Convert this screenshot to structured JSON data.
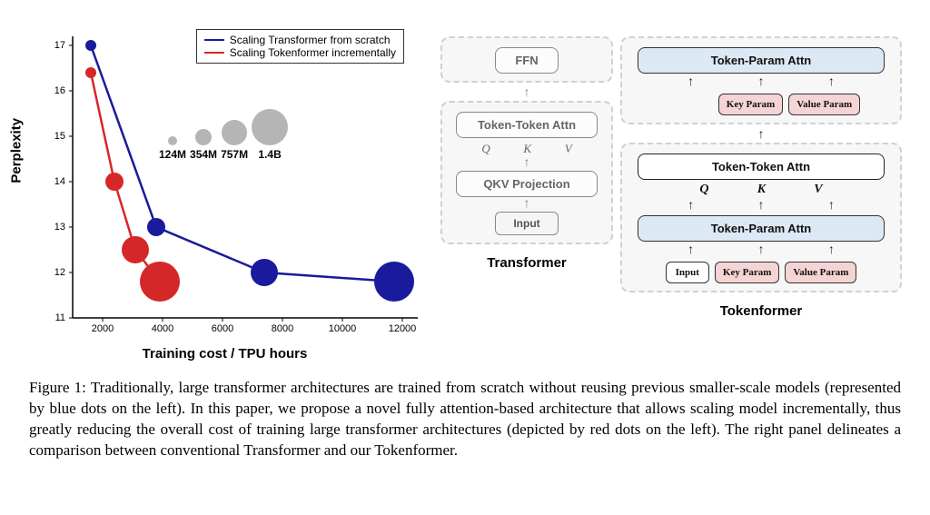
{
  "chart_data": {
    "type": "scatter-line",
    "xlabel": "Training cost / TPU hours",
    "ylabel": "Perplexity",
    "xlim": [
      1000,
      12500
    ],
    "ylim": [
      11,
      17.2
    ],
    "xticks": [
      2000,
      4000,
      6000,
      8000,
      10000,
      12000
    ],
    "yticks": [
      11,
      12,
      13,
      14,
      15,
      16,
      17
    ],
    "series": [
      {
        "name": "Scaling Transformer from scratch",
        "color": "#1a1a9c",
        "points": [
          {
            "x": 1600,
            "y": 17.0,
            "size": "124M"
          },
          {
            "x": 3800,
            "y": 13.0,
            "size": "354M"
          },
          {
            "x": 7400,
            "y": 12.0,
            "size": "757M"
          },
          {
            "x": 11700,
            "y": 11.8,
            "size": "1.4B"
          }
        ]
      },
      {
        "name": "Scaling Tokenformer incrementally",
        "color": "#d62728",
        "points": [
          {
            "x": 1600,
            "y": 16.4,
            "size": "124M"
          },
          {
            "x": 2400,
            "y": 14.0,
            "size": "354M"
          },
          {
            "x": 3100,
            "y": 12.5,
            "size": "757M"
          },
          {
            "x": 3900,
            "y": 11.8,
            "size": "1.4B"
          }
        ]
      }
    ],
    "size_legend": [
      "124M",
      "354M",
      "757M",
      "1.4B"
    ]
  },
  "legend": {
    "line1": "Scaling Transformer from scratch",
    "line2": "Scaling Tokenformer incrementally"
  },
  "size_keys": {
    "s0": "124M",
    "s1": "354M",
    "s2": "757M",
    "s3": "1.4B"
  },
  "arch_left": {
    "ffn": "FFN",
    "tta": "Token-Token Attn",
    "q": "Q",
    "k": "K",
    "v": "V",
    "qkv_proj": "QKV Projection",
    "input": "Input",
    "label": "Transformer"
  },
  "arch_right": {
    "tpa": "Token-Param Attn",
    "key_param": "Key Param",
    "value_param": "Value Param",
    "tta": "Token-Token Attn",
    "q": "Q",
    "k": "K",
    "v": "V",
    "input": "Input",
    "label": "Tokenformer"
  },
  "caption": "Figure 1: Traditionally, large transformer architectures are trained from scratch without reusing previous smaller-scale models (represented by blue dots on the left). In this paper, we propose a novel fully attention-based architecture that allows scaling model incrementally, thus greatly reducing the overall cost of training large transformer architectures (depicted by red dots on the left). The right panel delineates a comparison between conventional Transformer and our Tokenformer."
}
